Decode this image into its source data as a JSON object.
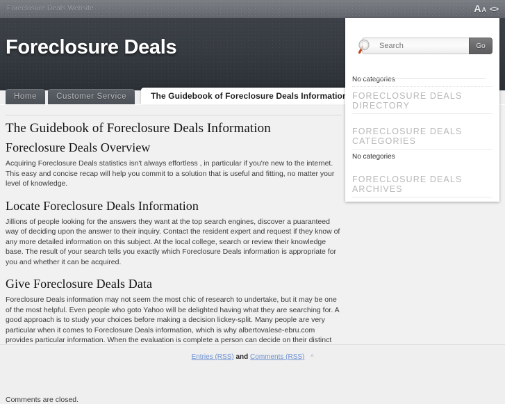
{
  "topbar": {
    "tagline": "Foreclosure Deals Website",
    "font_big": "A",
    "font_small": "A",
    "font_arrows": "<>"
  },
  "masthead": {
    "site_title": "Foreclosure Deals"
  },
  "nav": {
    "tabs": [
      {
        "label": "Home",
        "active": false
      },
      {
        "label": "Customer Service",
        "active": false
      },
      {
        "label": "The Guidebook of Foreclosure Deals Information",
        "active": true
      }
    ]
  },
  "sidebar": {
    "search": {
      "placeholder": "Search",
      "value": "",
      "go_label": "Go",
      "icon": "magnifier-icon"
    },
    "widgets": [
      {
        "type": "note",
        "text": "No categories"
      },
      {
        "type": "title",
        "text": "FORECLOSURE DEALS DIRECTORY"
      },
      {
        "type": "title",
        "text": "FORECLOSURE DEALS CATEGORIES"
      },
      {
        "type": "note",
        "text": "No categories"
      },
      {
        "type": "title",
        "text": "FORECLOSURE DEALS ARCHIVES"
      }
    ]
  },
  "main": {
    "entry_title": "The Guidebook of Foreclosure Deals Information",
    "sections": [
      {
        "heading": "Foreclosure Deals Overview",
        "paragraph": "Acquiring Foreclosure Deals statistics isn't always effortless , in particular if you're new to the internet. This easy and concise recap will help you commit to a solution that is useful and fitting, no matter your level of knowledge."
      },
      {
        "heading": "Locate Foreclosure Deals Information",
        "paragraph": "Jillions of people looking for the answers they want at the top search engines, discover a puaranteed way of deciding upon the answer to their inquiry. Contact the resident expert and request if they know of any more detailed information on this subject. At the local college, search or review their knowledge base. The result of your search tells you exactly which Foreclosure Deals information is appropriate for you and whether it can be acquired."
      },
      {
        "heading": "Give Foreclosure Deals Data",
        "paragraph": "Foreclosure Deals information may not seem the most chic of research to undertake, but it may be one of the most helpful. Even people who goto Yahoo will be delighted having what they are searching for. A good approach is to study your choices before making a decision lickey-split. Many people are very particular when it comes to Foreclosure Deals information, which is why albertovalese-ebru.com provides particular information. When the evaluation is complete a person can decide on their distinct style of statistics, then they are able to procure the affiliated products or services."
      }
    ],
    "comments_closed": "Comments are closed."
  },
  "footer": {
    "entries_rss": "Entries (RSS)",
    "and": "and",
    "comments_rss": "Comments (RSS)",
    "back_to_top": "^"
  },
  "colors": {
    "topbar": "#6e7278",
    "masthead": "#373c42",
    "page_bg": "#f1f1f1",
    "link": "#6a8fd0",
    "widget_title": "#b7b7b7",
    "search_icon_handle": "#c0451d"
  }
}
